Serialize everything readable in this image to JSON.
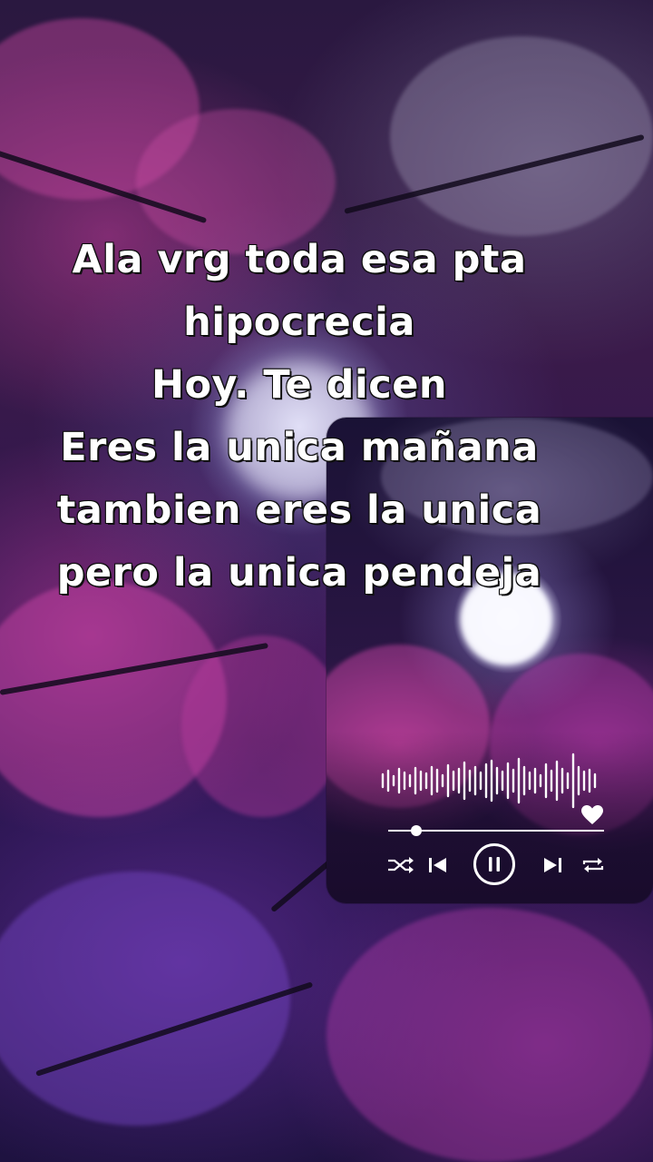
{
  "lyrics": {
    "lines": [
      "Ala vrg toda esa pta",
      "hipocrecia",
      "Hoy. Te dicen",
      "Eres la unica mañana",
      "tambien eres la unica",
      "pero la unica pendeja"
    ]
  },
  "player": {
    "progress_fraction": 0.13,
    "icons": {
      "waveform": "audio-waveform-icon",
      "like": "heart-icon",
      "shuffle": "shuffle-icon",
      "previous": "skip-previous-icon",
      "play_pause": "pause-icon",
      "next": "skip-next-icon",
      "repeat": "repeat-icon"
    }
  },
  "colors": {
    "text": "#ffffff",
    "text_outline": "#111111",
    "blossom_pink": "#c0449a",
    "night_purple": "#2a1550"
  }
}
